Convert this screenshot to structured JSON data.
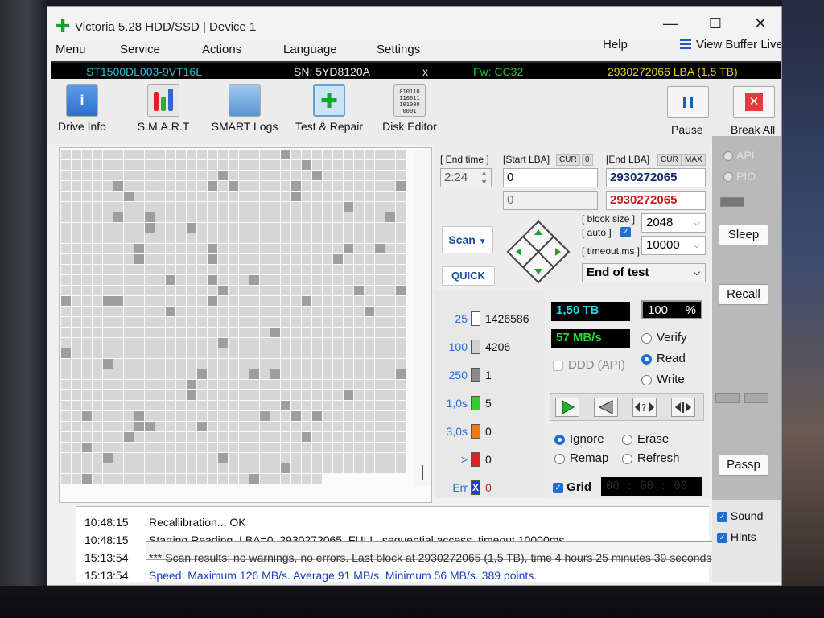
{
  "window": {
    "title": "Victoria 5.28 HDD/SSD | Device 1",
    "minimize": "—",
    "maximize": "☐",
    "close": "✕"
  },
  "menu": {
    "items": [
      "Menu",
      "Service",
      "Actions",
      "Language",
      "Settings",
      "Help"
    ],
    "view_buffer": "View Buffer Live"
  },
  "device": {
    "model": "ST1500DL003-9VT16L",
    "serial": "SN: 5YD8120A",
    "close": "x",
    "firmware": "Fw: CC32",
    "capacity": "2930272066 LBA (1,5 TB)"
  },
  "toolbar": {
    "drive_info": "Drive Info",
    "smart": "S.M.A.R.T",
    "smart_logs": "SMART Logs",
    "test_repair": "Test & Repair",
    "disk_editor": "Disk Editor",
    "pause": "Pause",
    "break_all": "Break All",
    "hex_glyph": "010110\n110011\n101000\n0001"
  },
  "scan": {
    "end_time_label": "[ End time ]",
    "end_time_value": "2:24",
    "start_lba_label": "[Start LBA]",
    "cur_tag": "CUR",
    "cur_value": "0",
    "start_lba_value": "0",
    "start_lba_current": "0",
    "end_lba_label": "[End LBA]",
    "max_tag": "MAX",
    "end_lba_value": "2930272065",
    "end_lba_current": "2930272065",
    "scan_button": "Scan",
    "quick_button": "QUICK",
    "block_size_label": "[ block size ]",
    "block_size_value": "2048",
    "auto_label": "[ auto ]",
    "timeout_label": "[ timeout,ms ]",
    "timeout_value": "10000",
    "end_action": "End of test"
  },
  "stats": [
    {
      "key": "25",
      "color": "#ffffff",
      "value": "1426586"
    },
    {
      "key": "100",
      "color": "#cfcfcf",
      "value": "4206"
    },
    {
      "key": "250",
      "color": "#8a8a8a",
      "value": "1"
    },
    {
      "key": "1,0s",
      "color": "#33cc33",
      "value": "5"
    },
    {
      "key": "3,0s",
      "color": "#f07a12",
      "value": "0"
    },
    {
      "key": ">",
      "color": "#e02020",
      "value": "0"
    },
    {
      "key": "Err",
      "color": "#1a3fd6",
      "value": "0",
      "mark": "X"
    }
  ],
  "info": {
    "capacity_lcd": "1,50 TB",
    "percent_value": "100",
    "percent_sign": "%",
    "speed_lcd": "57 MB/s",
    "ddd": "DDD (API)",
    "verify": "Verify",
    "read": "Read",
    "write": "Write",
    "ignore": "Ignore",
    "erase": "Erase",
    "remap": "Remap",
    "refresh": "Refresh",
    "grid": "Grid",
    "timer": "00 : 00 : 00"
  },
  "right": {
    "api": "API",
    "pio": "PIO",
    "sleep": "Sleep",
    "recall": "Recall",
    "passp": "Passp",
    "sound": "Sound",
    "hints": "Hints"
  },
  "log": [
    {
      "time": "10:48:15",
      "msg": "Recallibration... OK",
      "style": "black"
    },
    {
      "time": "10:48:15",
      "msg": "Starting Reading, LBA=0..2930272065, FULL, sequential access, timeout 10000ms",
      "style": "black"
    },
    {
      "time": "15:13:54",
      "msg": "*** Scan results: no warnings, no errors. Last block at 2930272065 (1,5 TB), time 4 hours 25 minutes 39 seconds.",
      "style": "gray"
    },
    {
      "time": "15:13:54",
      "msg": "Speed: Maximum 126 MB/s. Average 91 MB/s. Minimum 56 MB/s. 389 points.",
      "style": "blue"
    }
  ]
}
